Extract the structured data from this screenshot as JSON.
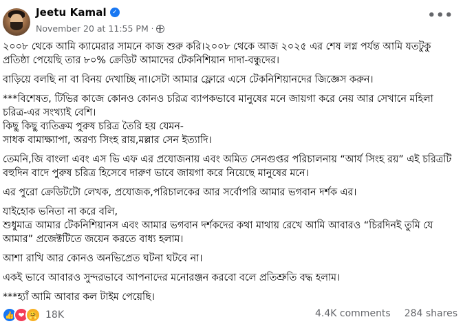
{
  "post": {
    "author": "Jeetu Kamal",
    "timestamp": "November 20 at 11:55 PM",
    "separator": "·",
    "more_icon": "•••",
    "verified_glyph": "✓",
    "paragraphs": [
      "২০০৮ থেকে আমি ক্যামেরার সামনে কাজ শুরু করি।২০০৮ থেকে আজ ২০২৫ এর শেষ লগ্ন পর্যন্ত আমি যতটুকু প্রতিষ্ঠা পেয়েছি তার ৮০% ক্রেডিট আমাদের টেকনিশিয়ান দাদা-বন্ধুদের।",
      "বাড়িয়ে বলছি না বা বিনয় দেখাচ্ছি না।সেটা আমার ফ্লোরে এসে টেকনিশিয়ানদের জিজ্ঞেস করুন।",
      "***বিশেষত, টিভির কাজে কোনও কোনও চরিত্র ব্যাপকভাবে মানুষের মনে জায়গা করে নেয় আর সেখানে মহিলা চরিত্র-এর সংখ্যাই বেশি।\nকিছু কিছু ব্যতিক্রম পুরুষ চরিত্র তৈরি হয় যেমন-\nসাধক বামাক্ষ্যাপা, অরণ্য সিংহ রায়,মল্লার সেন ইত্যাদি।",
      "তেমনি,জি বাংলা এবং এস ভি এফ এর প্রযোজনায় এবং অমিত সেনগুপ্তর পরিচালনায় “আর্য সিংহ রয়” এই চরিত্রটি বহুদিন বাদে পুরুষ চরিত্র হিসেবে দারুণ ভাবে জায়গা করে নিয়েছে মানুষের মনে।",
      "এর পুরো ক্রেডিটটো লেখক, প্রযোজক,পরিচালকের আর সর্বোপরি আমার ভগবান দর্শক এর।",
      "যাইহোক ভনিতা না করে বলি,\nশুধুমাত্র আমার টেকনিশিয়ানস এবং আমার ভগবান দর্শকদের কথা মাথায় রেখে আমি আবারও “চিরদিনই তুমি যে আমার” প্রজেক্টটিতে জয়েন করতে বাধ্য হলাম।",
      "আশা রাখি আর কোনও অনভিপ্রেত ঘটনা ঘটবে না।",
      "একই ভাবে আবারও সুন্দরভাবে আপনাদের মনোরঞ্জন করবো বলে প্রতিশ্রুতি বদ্ধ হলাম।",
      "***হ্যাঁ আমি আবার কল টাইম পেয়েছি।"
    ]
  },
  "footer": {
    "reaction_icons": [
      "like-icon",
      "love-icon",
      "care-icon"
    ],
    "reaction_glyphs": [
      "👍",
      "❤",
      "🤗"
    ],
    "reaction_count": "18K",
    "comments": "4.4K comments",
    "shares": "284 shares"
  }
}
